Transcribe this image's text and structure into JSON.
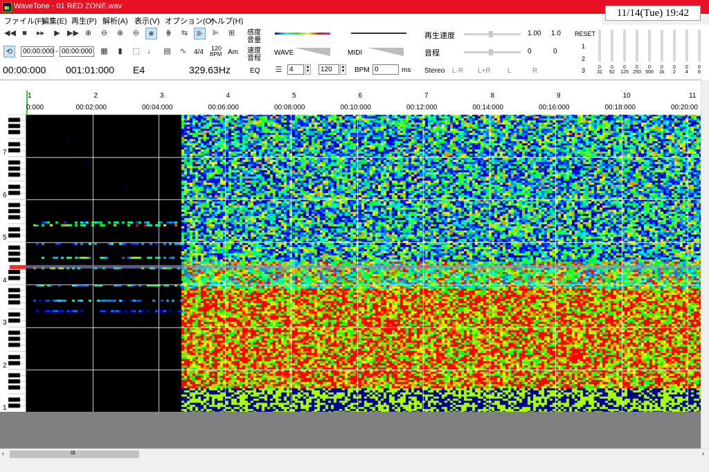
{
  "window": {
    "title": "WaveTone - 01 RED ZONE.wav",
    "clock": "11/14(Tue) 19:42"
  },
  "menu": [
    "ファイル(F)",
    "編集(E)",
    "再生(P)",
    "解析(A)",
    "表示(V)",
    "オプション(O)",
    "ヘルプ(H)"
  ],
  "toolbar": {
    "loop_start": "00:00:000",
    "loop_sep": "-",
    "loop_end": "00:00:000",
    "time_signature": "4/4",
    "bpm_icon_top": "120",
    "bpm_icon_bottom": "BPM",
    "chord_icon": "Am",
    "position": "00:00:000",
    "measure": "001:01:000",
    "note": "E4",
    "frequency": "329.63Hz",
    "sensitivity_volume_1": "感度",
    "sensitivity_volume_2": "音量",
    "speed_pitch_1": "速度",
    "speed_pitch_2": "音程",
    "wave_label": "WAVE",
    "midi_label": "MIDI",
    "eq_label": "EQ",
    "beats_value": "4",
    "bpm_value": "120",
    "bpm_label": "BPM",
    "offset_value": "0",
    "ms_label": "ms",
    "playback_speed_label": "再生速度",
    "playback_speed_value": "1.00",
    "playback_speed_value2": "1.0",
    "pitch_label": "音程",
    "pitch_value": "0",
    "pitch_value2": "0",
    "stereo_label": "Stereo",
    "stereo_lr": "L-R",
    "stereo_lplusr": "L+R",
    "stereo_l": "L",
    "stereo_r": "R",
    "eq_reset": "RESET",
    "eq_rows": [
      "1",
      "2",
      "3"
    ],
    "eq_bands": [
      "0\n31",
      "0\n62",
      "0\n125",
      "0\n250",
      "0\n500",
      "0\n1k",
      "0\n2",
      "0\n4",
      "0\n8"
    ]
  },
  "ruler": {
    "measures": [
      "1",
      "2",
      "3",
      "4",
      "5",
      "6",
      "7",
      "8",
      "9",
      "10",
      "11"
    ],
    "times": [
      "0:000",
      "00:02:000",
      "00:04:000",
      "00:06:000",
      "00:08:000",
      "00:10:000",
      "00:12:000",
      "00:14:000",
      "00:16:000",
      "00:18:000",
      "00:20:00"
    ]
  },
  "keyboard": {
    "octaves": [
      "7",
      "6",
      "5",
      "4",
      "3",
      "2",
      "1"
    ],
    "highlight_note": "E4"
  },
  "colors": {
    "titlebar": "#e81123",
    "highlight": "#e83030",
    "spectrum_hot": "#ff0000",
    "spectrum_cold": "#00008b"
  },
  "scrollbar": {
    "grip": "III"
  }
}
